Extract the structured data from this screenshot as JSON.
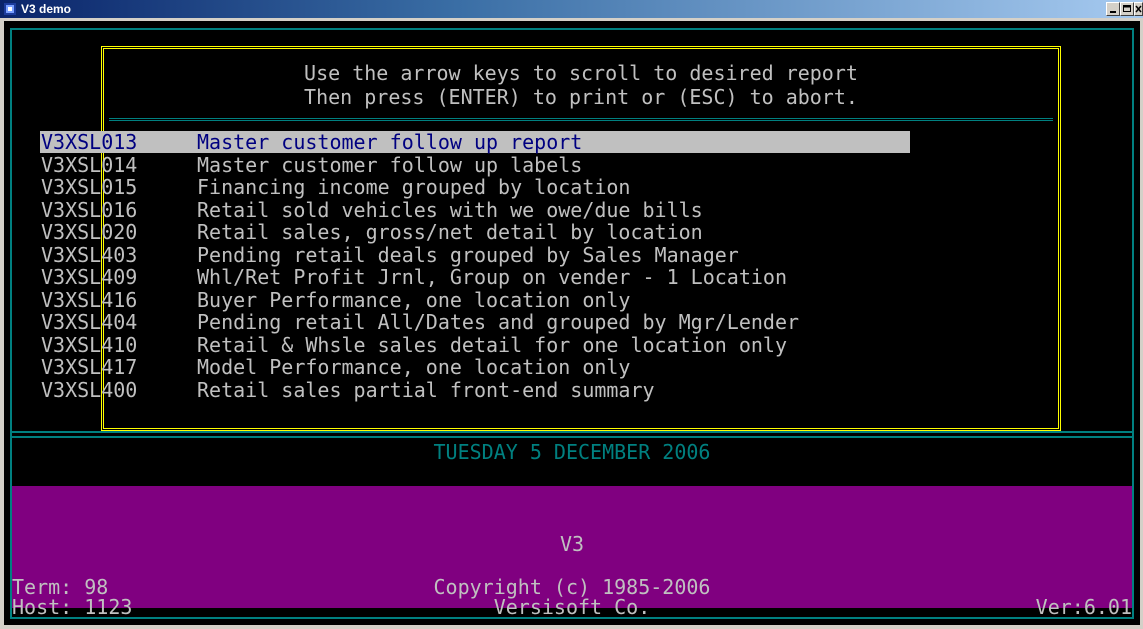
{
  "window": {
    "title": "V3 demo",
    "icon": "app-icon",
    "controls": [
      "minimize-icon",
      "maximize-icon",
      "close-icon"
    ]
  },
  "dialog": {
    "instruction_line1": "Use the arrow keys to scroll to desired report",
    "instruction_line2": "Then press (ENTER) to print or (ESC) to abort.",
    "selected_index": 0,
    "reports": [
      {
        "code": "V3XSL013",
        "description": "Master customer follow up report"
      },
      {
        "code": "V3XSL014",
        "description": "Master customer follow up labels"
      },
      {
        "code": "V3XSL015",
        "description": "Financing income grouped by location"
      },
      {
        "code": "V3XSL016",
        "description": "Retail sold vehicles with we owe/due bills"
      },
      {
        "code": "V3XSL020",
        "description": "Retail sales, gross/net detail by location"
      },
      {
        "code": "V3XSL403",
        "description": "Pending retail deals grouped by Sales Manager"
      },
      {
        "code": "V3XSL409",
        "description": "Whl/Ret Profit Jrnl, Group on vender - 1 Location"
      },
      {
        "code": "V3XSL416",
        "description": "Buyer Performance, one location only"
      },
      {
        "code": "V3XSL404",
        "description": "Pending retail All/Dates and grouped by Mgr/Lender"
      },
      {
        "code": "V3XSL410",
        "description": "Retail & Whsle sales detail for one location only"
      },
      {
        "code": "V3XSL417",
        "description": "Model Performance, one location only"
      },
      {
        "code": "V3XSL400",
        "description": "Retail sales partial front-end summary"
      }
    ]
  },
  "date_line": "TUESDAY 5 DECEMBER 2006",
  "footer": {
    "product": "V3",
    "term": "Term: 98",
    "host": "Host: 1123",
    "copyright": "Copyright (c) 1985-2006",
    "company": "Versisoft Co.",
    "version": "Ver:6.01"
  },
  "colors": {
    "terminal_bg": "#000000",
    "dialog_border": "#ffff00",
    "frame": "#008080",
    "panel": "#800080",
    "text": "#c0c0c0",
    "highlight_text": "#000080"
  }
}
